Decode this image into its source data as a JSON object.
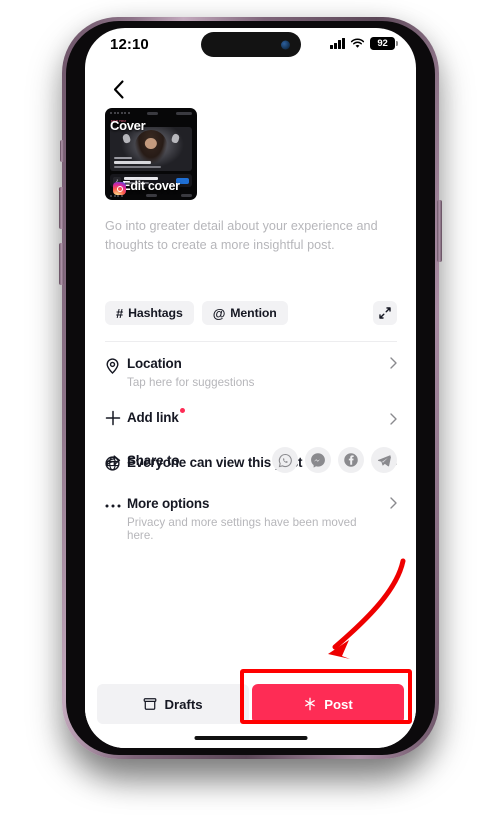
{
  "device": {
    "frame": "iphone-purple-titanium",
    "frame_color": "#8e7489"
  },
  "status_bar": {
    "time": "12:10",
    "signal_icon": "cellular-signal-icon",
    "wifi_icon": "wifi-icon",
    "battery_level": "92",
    "battery_icon": "battery-icon"
  },
  "nav": {
    "back_icon": "chevron-left-icon"
  },
  "cover": {
    "label": "Cover",
    "badge": "FOR YOU",
    "edit_label": "Edit cover",
    "instagram_icon": "instagram-icon",
    "music_icon": "music-note-icon"
  },
  "description": {
    "placeholder": "Go into greater detail about your experience and thoughts to create a more insightful post."
  },
  "tag_row": {
    "hashtags_label": "Hashtags",
    "hashtags_symbol": "#",
    "hashtags_icon": "hashtag-icon",
    "mention_label": "Mention",
    "mention_symbol": "@",
    "mention_icon": "at-mention-icon",
    "expand_icon": "expand-fullscreen-icon"
  },
  "options": [
    {
      "title": "Location",
      "subtitle": "Tap here for suggestions",
      "icon": "location-pin-icon",
      "chevron": "chevron-right-icon",
      "badge": false
    },
    {
      "title": "Add link",
      "subtitle": "",
      "icon": "plus-icon",
      "chevron": "chevron-right-icon",
      "badge": true
    },
    {
      "title": "Everyone can view this post",
      "subtitle": "",
      "icon": "globe-icon",
      "chevron": "chevron-right-icon",
      "badge": false
    },
    {
      "title": "More options",
      "subtitle": "Privacy and more settings have been moved here.",
      "icon": "ellipsis-icon",
      "chevron": "chevron-right-icon",
      "badge": false
    }
  ],
  "share": {
    "label": "Share to",
    "icon": "share-arrow-icon",
    "targets": [
      {
        "name": "WhatsApp",
        "icon": "whatsapp-icon"
      },
      {
        "name": "Messenger",
        "icon": "messenger-icon"
      },
      {
        "name": "Facebook",
        "icon": "facebook-icon"
      },
      {
        "name": "Telegram",
        "icon": "telegram-icon"
      }
    ]
  },
  "bottom_bar": {
    "drafts_label": "Drafts",
    "drafts_icon": "drafts-archive-icon",
    "post_label": "Post",
    "post_icon": "sparkle-icon",
    "post_color": "#fe2c55"
  },
  "annotations": {
    "highlight_color": "#ff0000",
    "arrow_color": "#ee0000",
    "highlight_target": "post-button",
    "arrow_target": "post-button"
  }
}
